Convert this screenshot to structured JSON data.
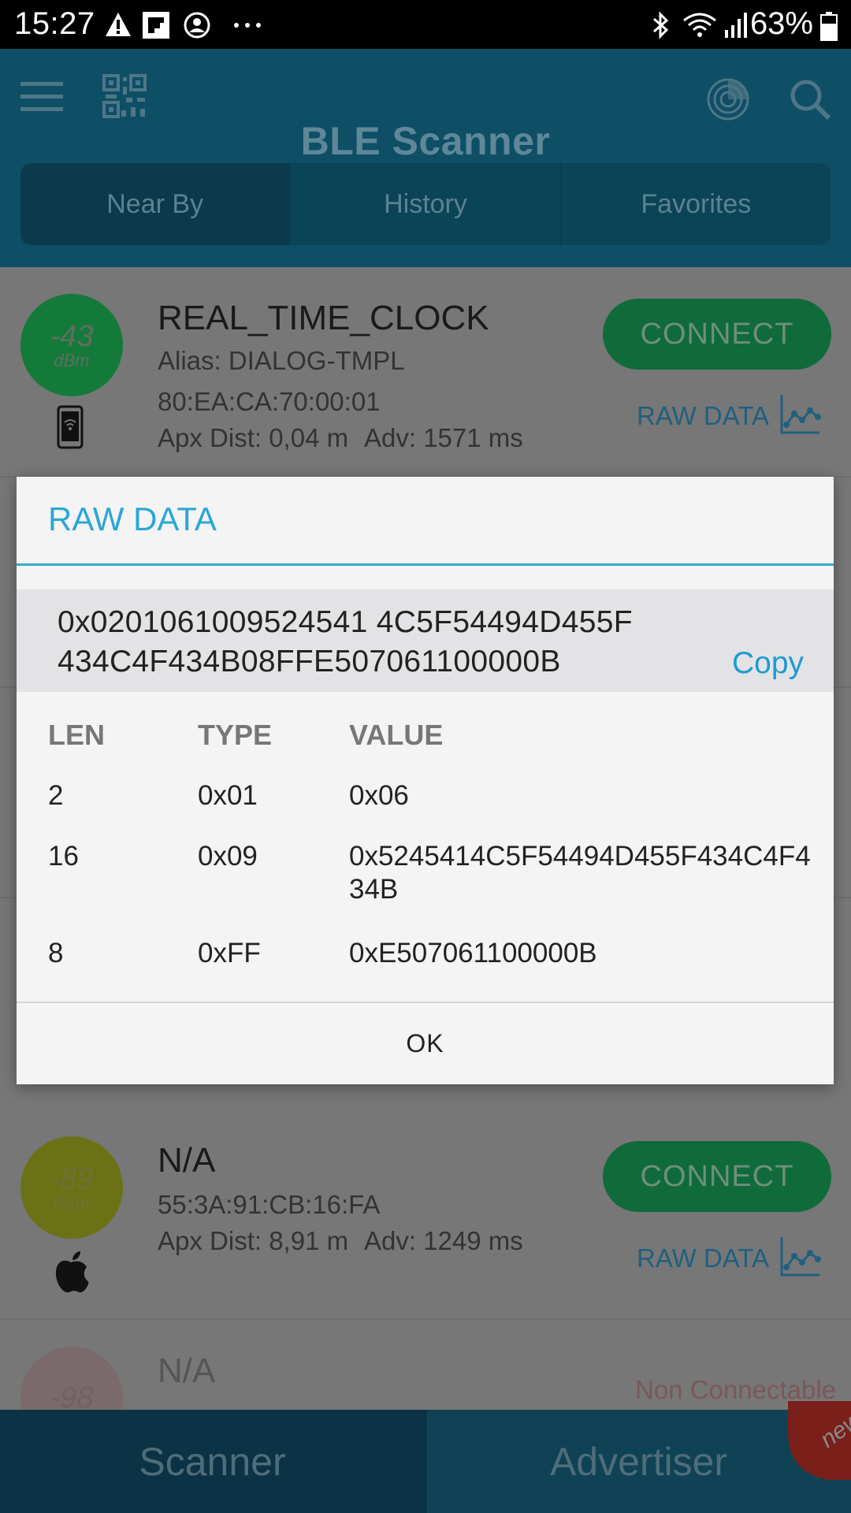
{
  "status_bar": {
    "time": "15:27",
    "battery": "63%",
    "icons": [
      "warning-icon",
      "flipboard-icon",
      "account-icon",
      "more-icon",
      "bluetooth-icon",
      "wifi-icon",
      "signal-icon",
      "battery-icon"
    ]
  },
  "app_bar": {
    "title": "BLE Scanner",
    "tabs": [
      {
        "label": "Near By"
      },
      {
        "label": "History"
      },
      {
        "label": "Favorites"
      }
    ]
  },
  "devices": [
    {
      "rssi": "-43",
      "unit": "dBm",
      "name": "REAL_TIME_CLOCK",
      "alias": "Alias: DIALOG-TMPL",
      "mac": "80:EA:CA:70:00:01",
      "dist": "Apx Dist: 0,04 m",
      "adv": "Adv: 1571 ms",
      "connect": "CONNECT",
      "raw": "RAW DATA",
      "rssi_color": "#147a3a"
    },
    {
      "rssi": "-89",
      "unit": "dBm",
      "name": "N/A",
      "mac": "55:3A:91:CB:16:FA",
      "dist": "Apx Dist: 8,91 m",
      "adv": "Adv: 1249 ms",
      "connect": "CONNECT",
      "raw": "RAW DATA",
      "rssi_color": "#6b7216"
    },
    {
      "rssi": "-98",
      "name": "N/A",
      "status": "Non Connectable",
      "rssi_color": "#7a6a6c"
    }
  ],
  "dialog": {
    "title": "RAW DATA",
    "hex_line1": "0x0201061009524541 4C5F54494D455F",
    "hex_line2": "434C4F434B08FFE507061100000B",
    "copy": "Copy",
    "headers": {
      "len": "LEN",
      "type": "TYPE",
      "value": "VALUE"
    },
    "rows": [
      {
        "len": "2",
        "type": "0x01",
        "value": "0x06"
      },
      {
        "len": "16",
        "type": "0x09",
        "value": "0x5245414C5F54494D455F434C4F434B"
      },
      {
        "len": "8",
        "type": "0xFF",
        "value": "0xE507061100000B"
      }
    ],
    "ok": "OK"
  },
  "bottom_nav": {
    "scanner": "Scanner",
    "advertiser": "Advertiser",
    "badge": "new"
  }
}
